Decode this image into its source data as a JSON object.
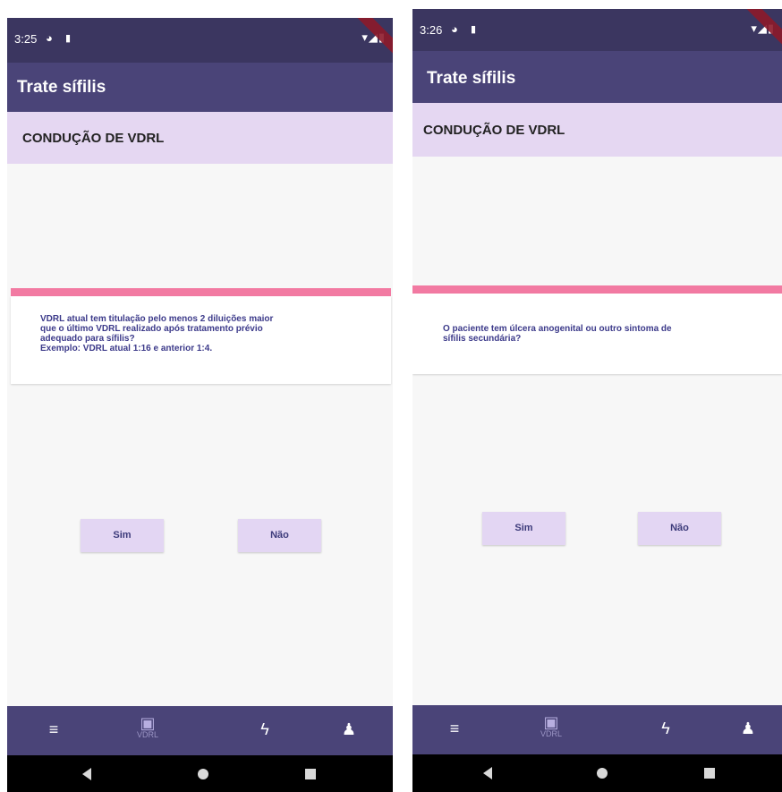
{
  "screens": [
    {
      "status": {
        "time": "3:25"
      },
      "app_title": "Trate sífilis",
      "section_title": "CONDUÇÃO DE VDRL",
      "question": "VDRL atual tem titulação pelo menos 2 diluições maior\nque o último VDRL realizado após tratamento prévio\nadequado para sífilis?\nExemplo: VDRL atual 1:16 e anterior 1:4.",
      "buttons": {
        "yes": "Sim",
        "no": "Não"
      },
      "bottom_nav": [
        {
          "icon": "menu-icon",
          "glyph": "≡",
          "label": ""
        },
        {
          "icon": "medical-kit-icon",
          "glyph": "▣",
          "label": "VDRL"
        },
        {
          "icon": "lightning-icon",
          "glyph": "ϟ",
          "label": ""
        },
        {
          "icon": "pregnant-person-icon",
          "glyph": "♟",
          "label": ""
        }
      ]
    },
    {
      "status": {
        "time": "3:26"
      },
      "app_title": "Trate sífilis",
      "section_title": "CONDUÇÃO DE VDRL",
      "question": "O paciente tem úlcera anogenital ou outro sintoma de\nsífilis secundária?",
      "buttons": {
        "yes": "Sim",
        "no": "Não"
      },
      "bottom_nav": [
        {
          "icon": "menu-icon",
          "glyph": "≡",
          "label": ""
        },
        {
          "icon": "medical-kit-icon",
          "glyph": "▣",
          "label": "VDRL"
        },
        {
          "icon": "lightning-icon",
          "glyph": "ϟ",
          "label": ""
        },
        {
          "icon": "pregnant-person-icon",
          "glyph": "♟",
          "label": ""
        }
      ]
    }
  ],
  "colors": {
    "status_bar": "#3b3660",
    "app_bar": "#4a4478",
    "section_header": "#e5d7f2",
    "accent_pink": "#f27aa2",
    "button_bg": "#e3d6f3",
    "question_text": "#3c3a8a"
  }
}
